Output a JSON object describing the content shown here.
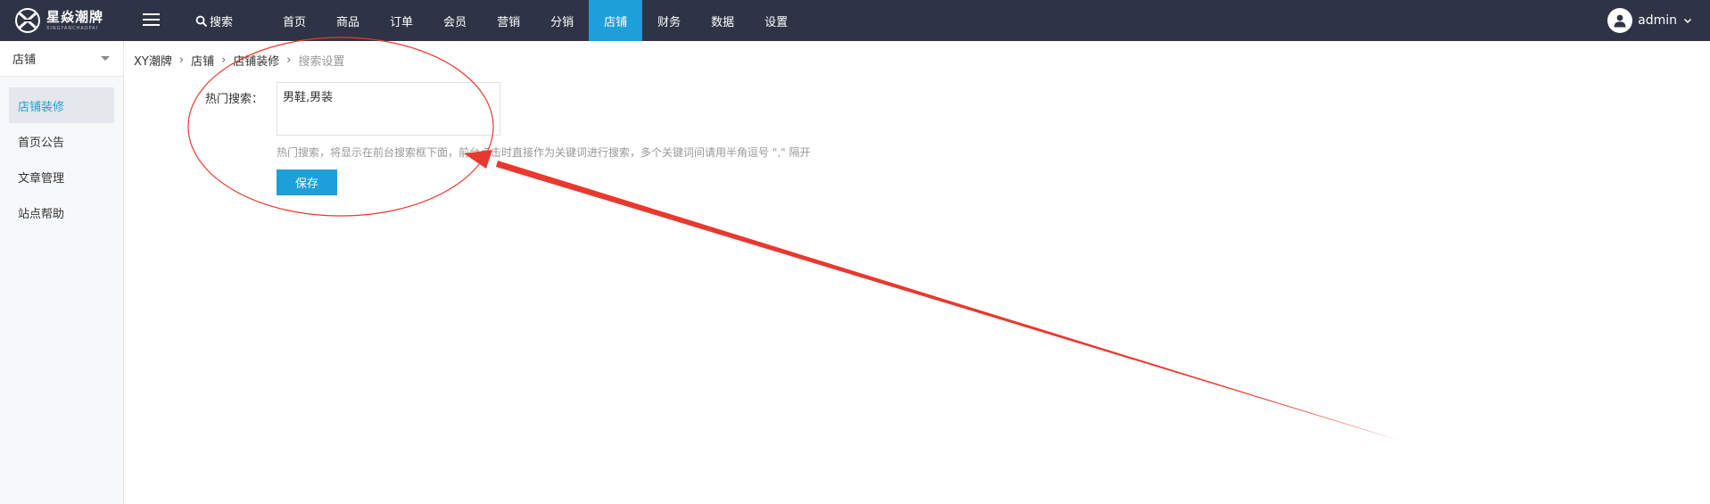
{
  "brand": {
    "title": "星焱潮牌",
    "subtitle": "XINGYANCHAOPAI",
    "icon": "logo-mark-icon"
  },
  "topbar": {
    "search_label": "搜索",
    "nav": [
      {
        "label": "首页",
        "active": false
      },
      {
        "label": "商品",
        "active": false
      },
      {
        "label": "订单",
        "active": false
      },
      {
        "label": "会员",
        "active": false
      },
      {
        "label": "营销",
        "active": false
      },
      {
        "label": "分销",
        "active": false
      },
      {
        "label": "店铺",
        "active": true
      },
      {
        "label": "财务",
        "active": false
      },
      {
        "label": "数据",
        "active": false
      },
      {
        "label": "设置",
        "active": false
      }
    ],
    "user": "admin"
  },
  "sidebar": {
    "header": "店铺",
    "items": [
      {
        "label": "店铺装修",
        "active": true
      },
      {
        "label": "首页公告",
        "active": false
      },
      {
        "label": "文章管理",
        "active": false
      },
      {
        "label": "站点帮助",
        "active": false
      }
    ]
  },
  "breadcrumb": [
    "XY潮牌",
    "店铺",
    "店铺装修",
    "搜索设置"
  ],
  "form": {
    "label": "热门搜索：",
    "value": "男鞋,男装",
    "hint": "热门搜索，将显示在前台搜索框下面，前台点击时直接作为关键词进行搜索，多个关键词间请用半角逗号 \",\" 隔开",
    "save_label": "保存"
  },
  "colors": {
    "topbar_bg": "#2e3446",
    "accent": "#1e9fd9",
    "annotation_red": "#e8392f"
  }
}
